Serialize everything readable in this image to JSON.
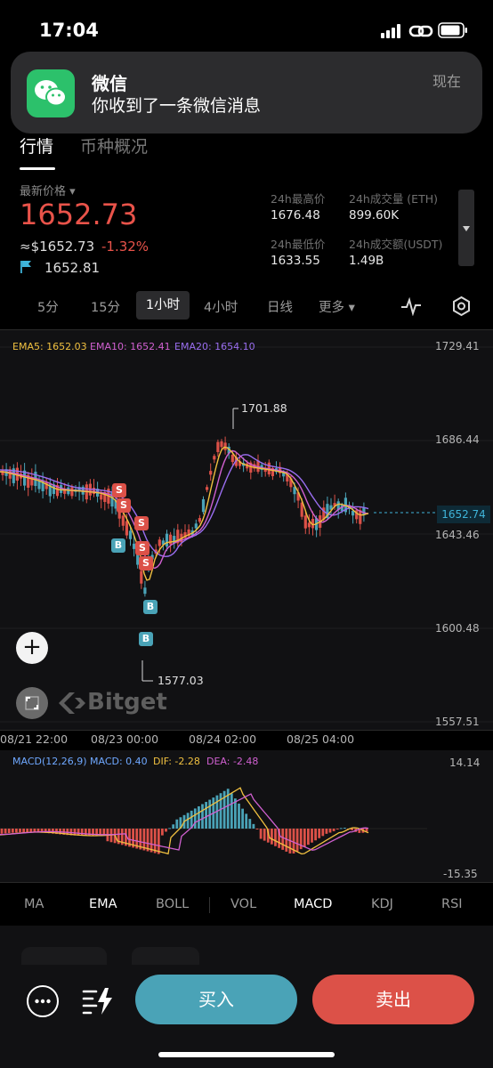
{
  "status_bar": {
    "time": "17:04"
  },
  "notification": {
    "app": "微信",
    "message": "你收到了一条微信消息",
    "time": "现在"
  },
  "tabs": {
    "market": "行情",
    "overview": "币种概况"
  },
  "price": {
    "latest_label": "最新价格 ▾",
    "last": "1652.73",
    "usd": "≈$1652.73",
    "change": "-1.32%",
    "mark": "1652.81"
  },
  "stats": {
    "high_label": "24h最高价",
    "high": "1676.48",
    "vol_eth_label": "24h成交量 (ETH)",
    "vol_eth": "899.60K",
    "low_label": "24h最低价",
    "low": "1633.55",
    "vol_usdt_label": "24h成交额(USDT)",
    "vol_usdt": "1.49B"
  },
  "timeframes": {
    "t5m": "5分",
    "t15m": "15分",
    "t1h": "1小时",
    "t4h": "4小时",
    "day": "日线",
    "more": "更多 ▾"
  },
  "ema_legend": {
    "ema5": "EMA5: 1652.03",
    "ema10": "EMA10: 1652.41",
    "ema20": "EMA20: 1654.10"
  },
  "y_axis": {
    "v1": "1729.41",
    "v2": "1686.44",
    "v3": "1643.46",
    "v4": "1600.48",
    "v5": "1557.51"
  },
  "current_price_tag": "1652.74",
  "annotations": {
    "high": "1701.88",
    "low": "1577.03"
  },
  "signals": {
    "sell": "S",
    "buy": "B"
  },
  "x_axis": {
    "d1": "08/21 22:00",
    "d2": "08/23 00:00",
    "d3": "08/24 02:00",
    "d4": "08/25 04:00"
  },
  "watermark": "Bitget",
  "macd_legend": {
    "params": "MACD(12,26,9)",
    "macd": "MACD: 0.40",
    "dif": "DIF: -2.28",
    "dea": "DEA: -2.48"
  },
  "macd_axis": {
    "top": "14.14",
    "bottom": "-15.35"
  },
  "indicators": {
    "ma": "MA",
    "ema": "EMA",
    "boll": "BOLL",
    "vol": "VOL",
    "macd": "MACD",
    "kdj": "KDJ",
    "rsi": "RSI"
  },
  "actions": {
    "buy": "买入",
    "sell": "卖出"
  },
  "colors": {
    "up": "#4aa3b7",
    "down": "#dc5148",
    "ema5": "#f0c040",
    "ema10": "#d060d0",
    "ema20": "#9a6ef0"
  }
}
